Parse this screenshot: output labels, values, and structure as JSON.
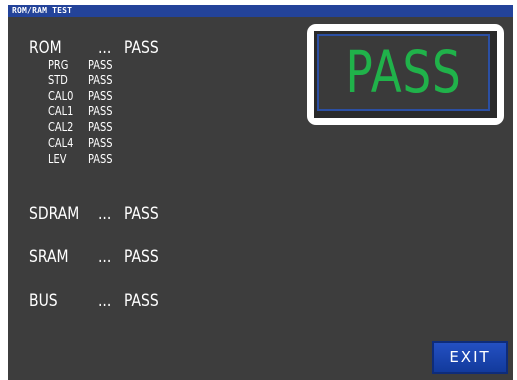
{
  "window": {
    "title": "ROM/RAM TEST"
  },
  "rom": {
    "label": "ROM",
    "dots": "...",
    "result": "PASS",
    "items": [
      {
        "name": "PRG",
        "result": "PASS"
      },
      {
        "name": "STD",
        "result": "PASS"
      },
      {
        "name": "CAL0",
        "result": "PASS"
      },
      {
        "name": "CAL1",
        "result": "PASS"
      },
      {
        "name": "CAL2",
        "result": "PASS"
      },
      {
        "name": "CAL4",
        "result": "PASS"
      },
      {
        "name": "LEV",
        "result": "PASS"
      }
    ]
  },
  "sdram": {
    "label": "SDRAM",
    "dots": "...",
    "result": "PASS"
  },
  "sram": {
    "label": "SRAM",
    "dots": "...",
    "result": "PASS"
  },
  "bus": {
    "label": "BUS",
    "dots": "...",
    "result": "PASS"
  },
  "overall": {
    "result": "PASS",
    "color": "#20b24a"
  },
  "exit_button": {
    "label": "EXIT"
  },
  "colors": {
    "title_bar": "#23439a",
    "screen_bg": "#3d3d3d",
    "button": "#1c45b0"
  }
}
